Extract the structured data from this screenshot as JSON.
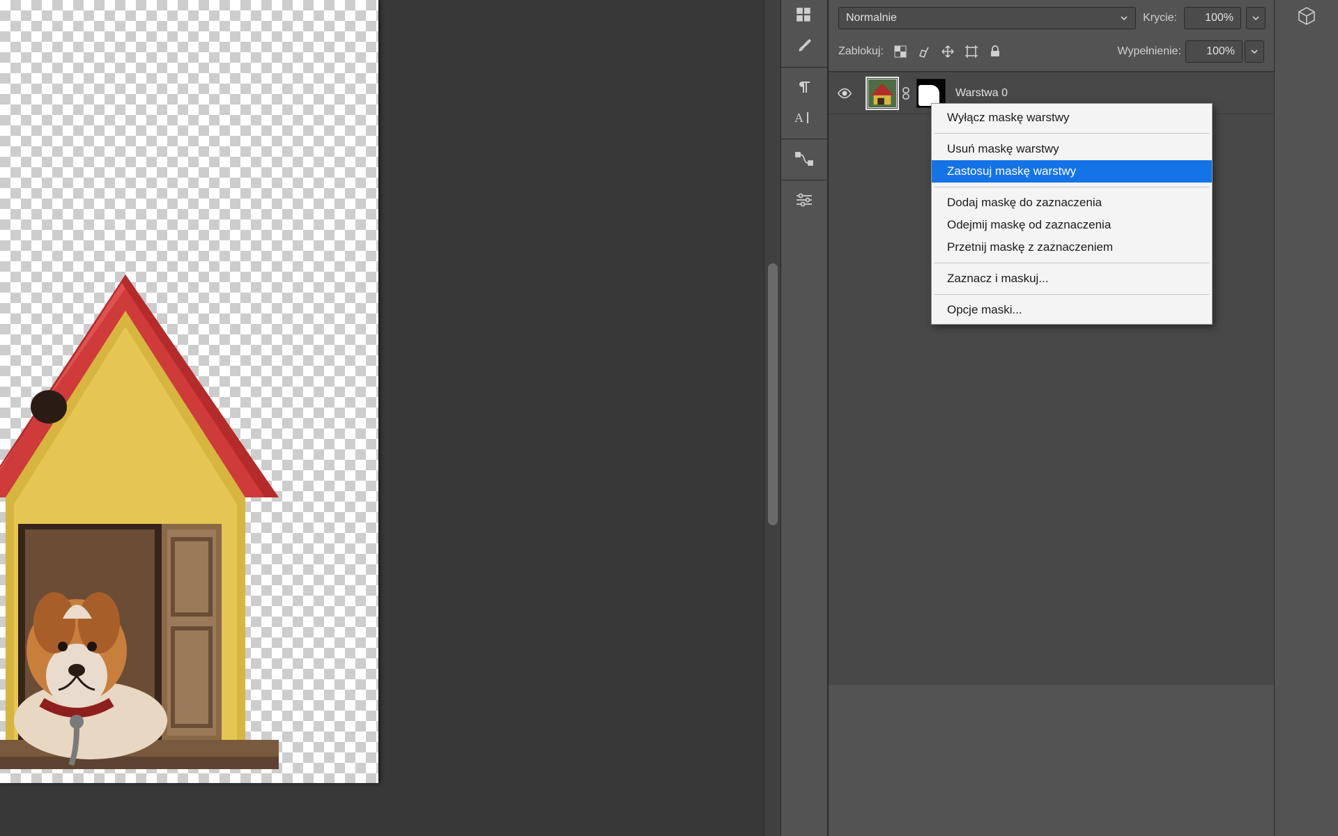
{
  "blend": {
    "mode_label": "Normalnie",
    "opacity_label": "Krycie:",
    "opacity_value": "100%",
    "lock_label": "Zablokuj:",
    "fill_label": "Wypełnienie:",
    "fill_value": "100%"
  },
  "layer": {
    "name": "Warstwa 0"
  },
  "context_menu": {
    "items": [
      {
        "label": "Wyłącz maskę warstwy",
        "type": "item"
      },
      {
        "type": "sep"
      },
      {
        "label": "Usuń maskę warstwy",
        "type": "item"
      },
      {
        "label": "Zastosuj maskę warstwy",
        "type": "item",
        "highlighted": true
      },
      {
        "type": "sep"
      },
      {
        "label": "Dodaj maskę do zaznaczenia",
        "type": "item"
      },
      {
        "label": "Odejmij maskę od zaznaczenia",
        "type": "item"
      },
      {
        "label": "Przetnij maskę z zaznaczeniem",
        "type": "item"
      },
      {
        "type": "sep"
      },
      {
        "label": "Zaznacz i maskuj...",
        "type": "item"
      },
      {
        "type": "sep"
      },
      {
        "label": "Opcje maski...",
        "type": "item"
      }
    ]
  },
  "vbar_icons": [
    {
      "name": "swatches-icon"
    },
    {
      "name": "brush-icon"
    },
    {
      "name": "sep"
    },
    {
      "name": "paragraph-icon"
    },
    {
      "name": "glyphs-icon"
    },
    {
      "name": "sep"
    },
    {
      "name": "paths-icon"
    },
    {
      "name": "sep"
    },
    {
      "name": "adjustments-icon"
    }
  ]
}
